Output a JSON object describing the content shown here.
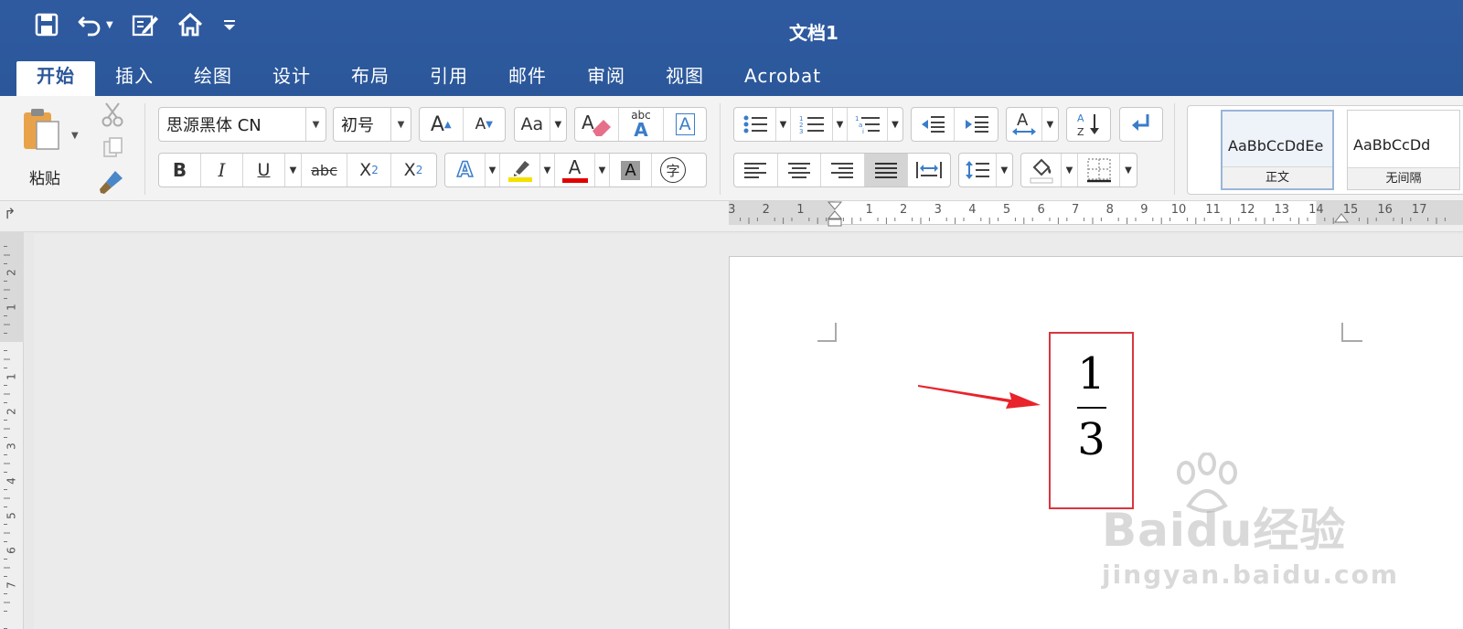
{
  "window": {
    "title": "文档1"
  },
  "quick_access": {
    "icons": [
      "save-icon",
      "undo-icon",
      "undo-dropdown-icon",
      "edit-doc-icon",
      "home-icon",
      "customize-dropdown-icon"
    ]
  },
  "tabs": [
    {
      "label": "开始",
      "active": true
    },
    {
      "label": "插入"
    },
    {
      "label": "绘图"
    },
    {
      "label": "设计"
    },
    {
      "label": "布局"
    },
    {
      "label": "引用"
    },
    {
      "label": "邮件"
    },
    {
      "label": "审阅"
    },
    {
      "label": "视图"
    },
    {
      "label": "Acrobat"
    }
  ],
  "clipboard": {
    "paste_label": "粘贴"
  },
  "font": {
    "name": "思源黑体 CN",
    "size": "初号"
  },
  "format_buttons": {
    "bold": "B",
    "italic": "I",
    "underline": "U",
    "strikethrough": "abc",
    "subscript": "X",
    "subscript_sub": "2",
    "superscript": "X",
    "superscript_sup": "2",
    "grow": "A",
    "shrink": "A",
    "case": "Aa",
    "text_effect": "A",
    "font_color": "A",
    "shading": "A",
    "enclose": "字",
    "phonetic_top": "abc",
    "phonetic_bottom": "A",
    "char_border": "A"
  },
  "sort_labels": {
    "a": "A",
    "z": "Z"
  },
  "styles": [
    {
      "sample": "AaBbCcDdEe",
      "name": "正文",
      "selected": true
    },
    {
      "sample": "AaBbCcDd",
      "name": "无间隔"
    }
  ],
  "ruler": {
    "horizontal_labels": [
      "3",
      "2",
      "1",
      "1",
      "2",
      "3",
      "4",
      "5",
      "6",
      "7",
      "8",
      "9",
      "10",
      "11",
      "12",
      "13",
      "14",
      "15",
      "16",
      "17"
    ],
    "vertical_labels": [
      "2",
      "1",
      "1",
      "2",
      "3",
      "4",
      "5",
      "6",
      "7"
    ]
  },
  "document": {
    "fraction": {
      "numerator": "1",
      "denominator": "3"
    },
    "highlight_color": "#d9363e",
    "arrow_color": "#e8232b"
  },
  "watermark": {
    "brand": "Baidu经验",
    "url": "jingyan.baidu.com"
  },
  "colors": {
    "accent": "#2b579a",
    "font_color_bar": "#e00000",
    "highlight_bar": "#f5e000"
  }
}
